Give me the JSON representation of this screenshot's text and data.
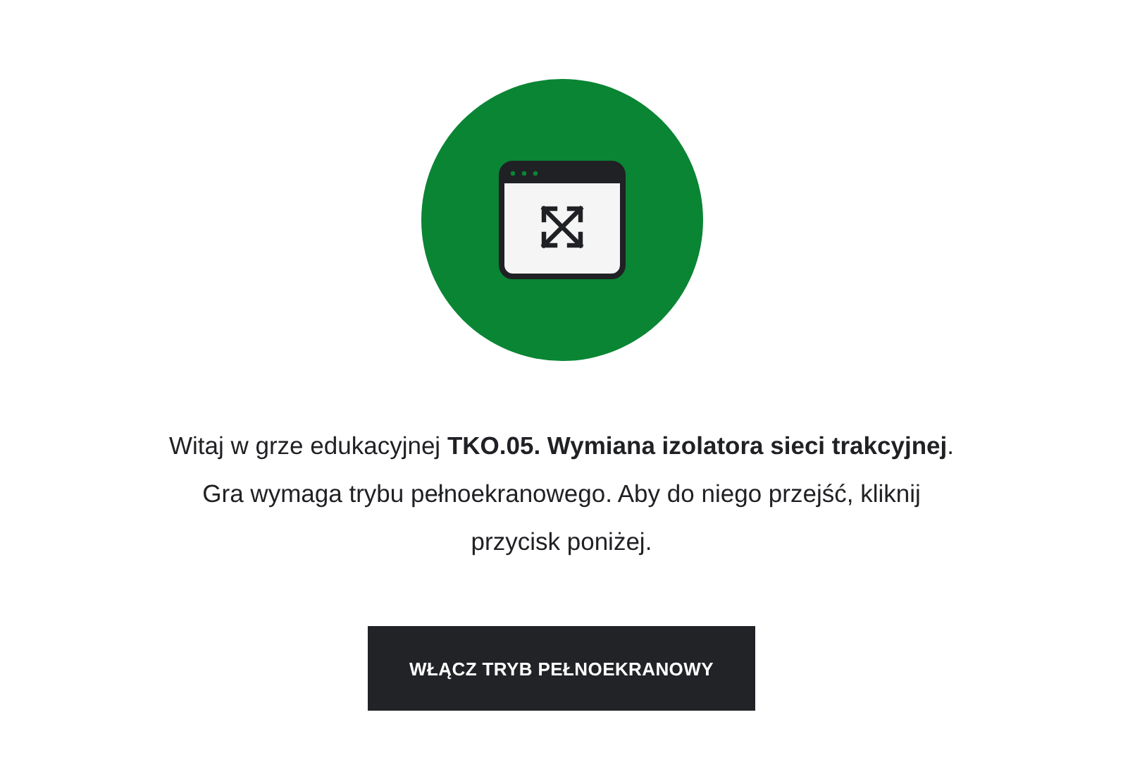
{
  "intro": {
    "text": "Witaj w grze edukacyjnej **TKO.05. Wymiana izolatora sieci trakcyjnej**. Gra wymaga trybu pełnoekranowego. Aby do niego przejść, kliknij przycisk poniżej."
  },
  "button": {
    "label": "WŁĄCZ TRYB PEŁNOEKRANOWY"
  }
}
